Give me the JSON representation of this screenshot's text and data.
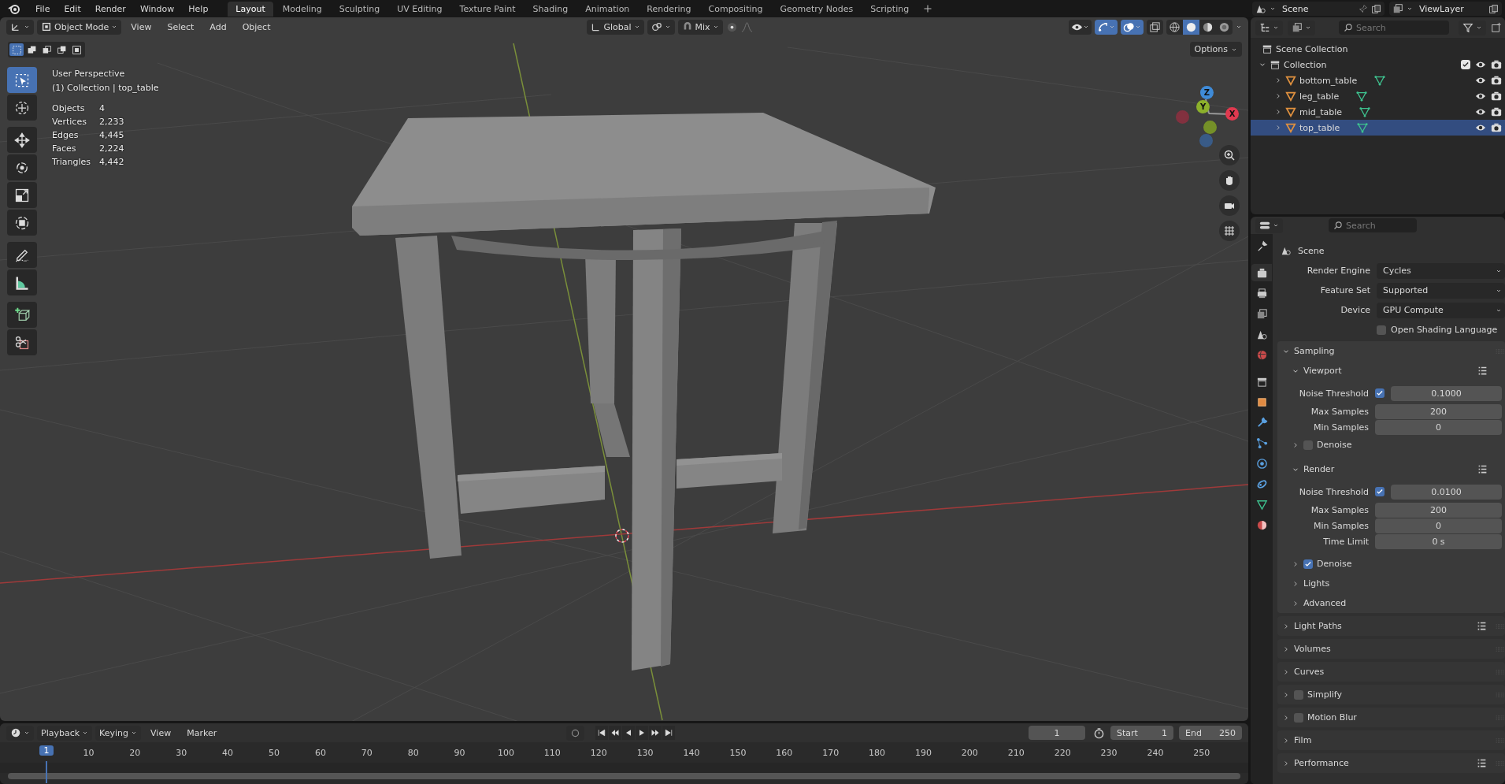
{
  "menu": [
    "File",
    "Edit",
    "Render",
    "Window",
    "Help"
  ],
  "workspaces": [
    {
      "label": "Layout",
      "selected": true
    },
    {
      "label": "Modeling",
      "selected": false
    },
    {
      "label": "Sculpting",
      "selected": false
    },
    {
      "label": "UV Editing",
      "selected": false
    },
    {
      "label": "Texture Paint",
      "selected": false
    },
    {
      "label": "Shading",
      "selected": false
    },
    {
      "label": "Animation",
      "selected": false
    },
    {
      "label": "Rendering",
      "selected": false
    },
    {
      "label": "Compositing",
      "selected": false
    },
    {
      "label": "Geometry Nodes",
      "selected": false
    },
    {
      "label": "Scripting",
      "selected": false
    }
  ],
  "scene": "Scene",
  "view_layer": "ViewLayer",
  "viewport": {
    "mode": "Object Mode",
    "menus": [
      "View",
      "Select",
      "Add",
      "Object"
    ],
    "orientation": "Global",
    "pivot": "Mix",
    "select_modes": [
      {
        "selected": true
      },
      {
        "selected": false
      },
      {
        "selected": false
      },
      {
        "selected": false
      },
      {
        "selected": false
      }
    ],
    "toggles": [
      {
        "kind": "selectability",
        "on": false
      },
      {
        "kind": "gizmos",
        "on": true
      },
      {
        "kind": "overlays",
        "on": true
      },
      {
        "kind": "xray",
        "on": false
      }
    ],
    "shading": [
      {
        "kind": "wireframe",
        "selected": false
      },
      {
        "kind": "solid",
        "selected": true
      },
      {
        "kind": "material",
        "selected": false
      },
      {
        "kind": "rendered",
        "selected": false
      }
    ],
    "options": "Options",
    "title": "User Perspective",
    "context": "(1) Collection | top_table",
    "stats": [
      {
        "label": "Objects",
        "value": "4"
      },
      {
        "label": "Vertices",
        "value": "2,233"
      },
      {
        "label": "Edges",
        "value": "4,445"
      },
      {
        "label": "Faces",
        "value": "2,224"
      },
      {
        "label": "Triangles",
        "value": "4,442"
      }
    ],
    "tools": [
      {
        "kind": "select",
        "selected": true
      },
      {
        "kind": "cursor",
        "selected": false
      },
      {
        "kind": "move",
        "selected": false
      },
      {
        "kind": "rotate",
        "selected": false
      },
      {
        "kind": "scale",
        "selected": false
      },
      {
        "kind": "transform",
        "selected": false
      },
      {
        "kind": "annotate",
        "selected": false
      },
      {
        "kind": "measure",
        "selected": false
      },
      {
        "kind": "add_cube",
        "selected": false
      },
      {
        "kind": "cut",
        "selected": false
      }
    ],
    "gizmo": [
      "X",
      "Y",
      "Z"
    ]
  },
  "outliner": {
    "placeholder": "Search",
    "root": "Scene Collection",
    "tree": [
      {
        "label": "Collection",
        "expanded": true,
        "checked": true,
        "children": [
          {
            "label": "bottom_table",
            "expanded": false,
            "selected": false
          },
          {
            "label": "leg_table",
            "expanded": false,
            "selected": false
          },
          {
            "label": "mid_table",
            "expanded": false,
            "selected": false
          },
          {
            "label": "top_table",
            "expanded": false,
            "selected": true
          }
        ]
      }
    ]
  },
  "properties": {
    "placeholder": "Search",
    "context": "Scene",
    "tabs": [
      {
        "kind": "tool",
        "selected": false
      },
      {
        "kind": "render",
        "selected": true
      },
      {
        "kind": "output",
        "selected": false
      },
      {
        "kind": "view_layer",
        "selected": false
      },
      {
        "kind": "scene",
        "selected": false
      },
      {
        "kind": "world",
        "selected": false
      },
      {
        "kind": "collection",
        "selected": false
      },
      {
        "kind": "object",
        "selected": false
      },
      {
        "kind": "modifiers",
        "selected": false
      },
      {
        "kind": "particles",
        "selected": false
      },
      {
        "kind": "physics",
        "selected": false
      },
      {
        "kind": "constraints",
        "selected": false
      },
      {
        "kind": "data",
        "selected": false
      },
      {
        "kind": "material",
        "selected": false
      }
    ],
    "fields": [
      {
        "kind": "dropdown",
        "label": "Render Engine",
        "value": "Cycles"
      },
      {
        "kind": "dropdown",
        "label": "Feature Set",
        "value": "Supported"
      },
      {
        "kind": "dropdown",
        "label": "Device",
        "value": "GPU Compute"
      },
      {
        "kind": "checkbox",
        "label": "Open Shading Language",
        "checked": false
      }
    ],
    "panels": [
      {
        "label": "Sampling",
        "expanded": true,
        "presets": false,
        "children": [
          {
            "kind": "subpanel",
            "label": "Viewport",
            "expanded": true,
            "presets": true,
            "children": [
              {
                "kind": "toggle_number",
                "label": "Noise Threshold",
                "checked": true,
                "value": "0.1000"
              },
              {
                "kind": "number",
                "label": "Max Samples",
                "value": "200"
              },
              {
                "kind": "number",
                "label": "Min Samples",
                "value": "0"
              },
              {
                "kind": "subpanel",
                "label": "Denoise",
                "expanded": false,
                "checked": false,
                "presets": false
              }
            ]
          },
          {
            "kind": "subpanel",
            "label": "Render",
            "expanded": true,
            "presets": true,
            "children": [
              {
                "kind": "toggle_number",
                "label": "Noise Threshold",
                "checked": true,
                "value": "0.0100"
              },
              {
                "kind": "number",
                "label": "Max Samples",
                "value": "200"
              },
              {
                "kind": "number",
                "label": "Min Samples",
                "value": "0"
              },
              {
                "kind": "number",
                "label": "Time Limit",
                "value": "0 s"
              }
            ]
          },
          {
            "kind": "subpanel",
            "label": "Denoise",
            "expanded": false,
            "checked": true,
            "presets": false
          },
          {
            "kind": "subpanel",
            "label": "Lights",
            "expanded": false,
            "presets": false
          },
          {
            "kind": "subpanel",
            "label": "Advanced",
            "expanded": false,
            "presets": false
          }
        ]
      },
      {
        "label": "Light Paths",
        "expanded": false,
        "presets": true
      },
      {
        "label": "Volumes",
        "expanded": false,
        "presets": false
      },
      {
        "label": "Curves",
        "expanded": false,
        "presets": false
      },
      {
        "label": "Simplify",
        "expanded": false,
        "checked": false,
        "presets": false
      },
      {
        "label": "Motion Blur",
        "expanded": false,
        "checked": false,
        "presets": false
      },
      {
        "label": "Film",
        "expanded": false,
        "presets": false
      },
      {
        "label": "Performance",
        "expanded": false,
        "presets": true
      }
    ]
  },
  "timeline": {
    "menus": [
      {
        "label": "Playback",
        "kind": "dropdown"
      },
      {
        "label": "Keying",
        "kind": "dropdown"
      },
      {
        "label": "View",
        "kind": "menu"
      },
      {
        "label": "Marker",
        "kind": "menu"
      }
    ],
    "current_frame": "1",
    "start_label": "Start",
    "start": "1",
    "end_label": "End",
    "end": "250",
    "marker": "1",
    "ticks": [
      "10",
      "20",
      "30",
      "40",
      "50",
      "60",
      "70",
      "80",
      "90",
      "100",
      "110",
      "120",
      "130",
      "140",
      "150",
      "160",
      "170",
      "180",
      "190",
      "200",
      "210",
      "220",
      "230",
      "240",
      "250"
    ]
  }
}
